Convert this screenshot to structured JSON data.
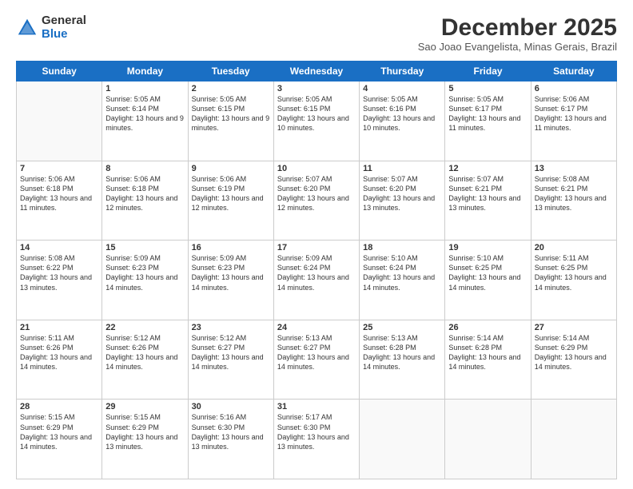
{
  "header": {
    "logo_general": "General",
    "logo_blue": "Blue",
    "title": "December 2025",
    "subtitle": "Sao Joao Evangelista, Minas Gerais, Brazil"
  },
  "days_of_week": [
    "Sunday",
    "Monday",
    "Tuesday",
    "Wednesday",
    "Thursday",
    "Friday",
    "Saturday"
  ],
  "weeks": [
    [
      {
        "day": "",
        "sunrise": "",
        "sunset": "",
        "daylight": ""
      },
      {
        "day": "1",
        "sunrise": "Sunrise: 5:05 AM",
        "sunset": "Sunset: 6:14 PM",
        "daylight": "Daylight: 13 hours and 9 minutes."
      },
      {
        "day": "2",
        "sunrise": "Sunrise: 5:05 AM",
        "sunset": "Sunset: 6:15 PM",
        "daylight": "Daylight: 13 hours and 9 minutes."
      },
      {
        "day": "3",
        "sunrise": "Sunrise: 5:05 AM",
        "sunset": "Sunset: 6:15 PM",
        "daylight": "Daylight: 13 hours and 10 minutes."
      },
      {
        "day": "4",
        "sunrise": "Sunrise: 5:05 AM",
        "sunset": "Sunset: 6:16 PM",
        "daylight": "Daylight: 13 hours and 10 minutes."
      },
      {
        "day": "5",
        "sunrise": "Sunrise: 5:05 AM",
        "sunset": "Sunset: 6:17 PM",
        "daylight": "Daylight: 13 hours and 11 minutes."
      },
      {
        "day": "6",
        "sunrise": "Sunrise: 5:06 AM",
        "sunset": "Sunset: 6:17 PM",
        "daylight": "Daylight: 13 hours and 11 minutes."
      }
    ],
    [
      {
        "day": "7",
        "sunrise": "Sunrise: 5:06 AM",
        "sunset": "Sunset: 6:18 PM",
        "daylight": "Daylight: 13 hours and 11 minutes."
      },
      {
        "day": "8",
        "sunrise": "Sunrise: 5:06 AM",
        "sunset": "Sunset: 6:18 PM",
        "daylight": "Daylight: 13 hours and 12 minutes."
      },
      {
        "day": "9",
        "sunrise": "Sunrise: 5:06 AM",
        "sunset": "Sunset: 6:19 PM",
        "daylight": "Daylight: 13 hours and 12 minutes."
      },
      {
        "day": "10",
        "sunrise": "Sunrise: 5:07 AM",
        "sunset": "Sunset: 6:20 PM",
        "daylight": "Daylight: 13 hours and 12 minutes."
      },
      {
        "day": "11",
        "sunrise": "Sunrise: 5:07 AM",
        "sunset": "Sunset: 6:20 PM",
        "daylight": "Daylight: 13 hours and 13 minutes."
      },
      {
        "day": "12",
        "sunrise": "Sunrise: 5:07 AM",
        "sunset": "Sunset: 6:21 PM",
        "daylight": "Daylight: 13 hours and 13 minutes."
      },
      {
        "day": "13",
        "sunrise": "Sunrise: 5:08 AM",
        "sunset": "Sunset: 6:21 PM",
        "daylight": "Daylight: 13 hours and 13 minutes."
      }
    ],
    [
      {
        "day": "14",
        "sunrise": "Sunrise: 5:08 AM",
        "sunset": "Sunset: 6:22 PM",
        "daylight": "Daylight: 13 hours and 13 minutes."
      },
      {
        "day": "15",
        "sunrise": "Sunrise: 5:09 AM",
        "sunset": "Sunset: 6:23 PM",
        "daylight": "Daylight: 13 hours and 14 minutes."
      },
      {
        "day": "16",
        "sunrise": "Sunrise: 5:09 AM",
        "sunset": "Sunset: 6:23 PM",
        "daylight": "Daylight: 13 hours and 14 minutes."
      },
      {
        "day": "17",
        "sunrise": "Sunrise: 5:09 AM",
        "sunset": "Sunset: 6:24 PM",
        "daylight": "Daylight: 13 hours and 14 minutes."
      },
      {
        "day": "18",
        "sunrise": "Sunrise: 5:10 AM",
        "sunset": "Sunset: 6:24 PM",
        "daylight": "Daylight: 13 hours and 14 minutes."
      },
      {
        "day": "19",
        "sunrise": "Sunrise: 5:10 AM",
        "sunset": "Sunset: 6:25 PM",
        "daylight": "Daylight: 13 hours and 14 minutes."
      },
      {
        "day": "20",
        "sunrise": "Sunrise: 5:11 AM",
        "sunset": "Sunset: 6:25 PM",
        "daylight": "Daylight: 13 hours and 14 minutes."
      }
    ],
    [
      {
        "day": "21",
        "sunrise": "Sunrise: 5:11 AM",
        "sunset": "Sunset: 6:26 PM",
        "daylight": "Daylight: 13 hours and 14 minutes."
      },
      {
        "day": "22",
        "sunrise": "Sunrise: 5:12 AM",
        "sunset": "Sunset: 6:26 PM",
        "daylight": "Daylight: 13 hours and 14 minutes."
      },
      {
        "day": "23",
        "sunrise": "Sunrise: 5:12 AM",
        "sunset": "Sunset: 6:27 PM",
        "daylight": "Daylight: 13 hours and 14 minutes."
      },
      {
        "day": "24",
        "sunrise": "Sunrise: 5:13 AM",
        "sunset": "Sunset: 6:27 PM",
        "daylight": "Daylight: 13 hours and 14 minutes."
      },
      {
        "day": "25",
        "sunrise": "Sunrise: 5:13 AM",
        "sunset": "Sunset: 6:28 PM",
        "daylight": "Daylight: 13 hours and 14 minutes."
      },
      {
        "day": "26",
        "sunrise": "Sunrise: 5:14 AM",
        "sunset": "Sunset: 6:28 PM",
        "daylight": "Daylight: 13 hours and 14 minutes."
      },
      {
        "day": "27",
        "sunrise": "Sunrise: 5:14 AM",
        "sunset": "Sunset: 6:29 PM",
        "daylight": "Daylight: 13 hours and 14 minutes."
      }
    ],
    [
      {
        "day": "28",
        "sunrise": "Sunrise: 5:15 AM",
        "sunset": "Sunset: 6:29 PM",
        "daylight": "Daylight: 13 hours and 14 minutes."
      },
      {
        "day": "29",
        "sunrise": "Sunrise: 5:15 AM",
        "sunset": "Sunset: 6:29 PM",
        "daylight": "Daylight: 13 hours and 13 minutes."
      },
      {
        "day": "30",
        "sunrise": "Sunrise: 5:16 AM",
        "sunset": "Sunset: 6:30 PM",
        "daylight": "Daylight: 13 hours and 13 minutes."
      },
      {
        "day": "31",
        "sunrise": "Sunrise: 5:17 AM",
        "sunset": "Sunset: 6:30 PM",
        "daylight": "Daylight: 13 hours and 13 minutes."
      },
      {
        "day": "",
        "sunrise": "",
        "sunset": "",
        "daylight": ""
      },
      {
        "day": "",
        "sunrise": "",
        "sunset": "",
        "daylight": ""
      },
      {
        "day": "",
        "sunrise": "",
        "sunset": "",
        "daylight": ""
      }
    ]
  ]
}
